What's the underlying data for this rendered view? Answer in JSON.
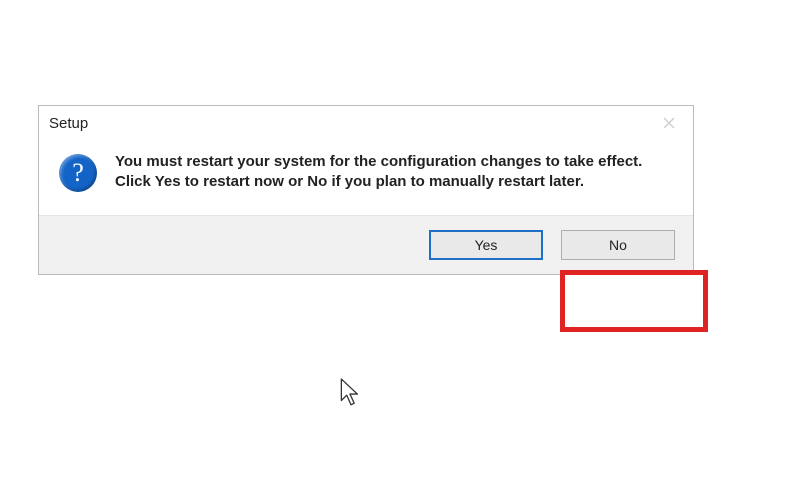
{
  "dialog": {
    "title": "Setup",
    "icon_glyph": "?",
    "message": "You must restart your system for the configuration changes to take effect. Click Yes to restart now or No if you plan to manually restart later.",
    "buttons": {
      "yes": "Yes",
      "no": "No"
    }
  }
}
